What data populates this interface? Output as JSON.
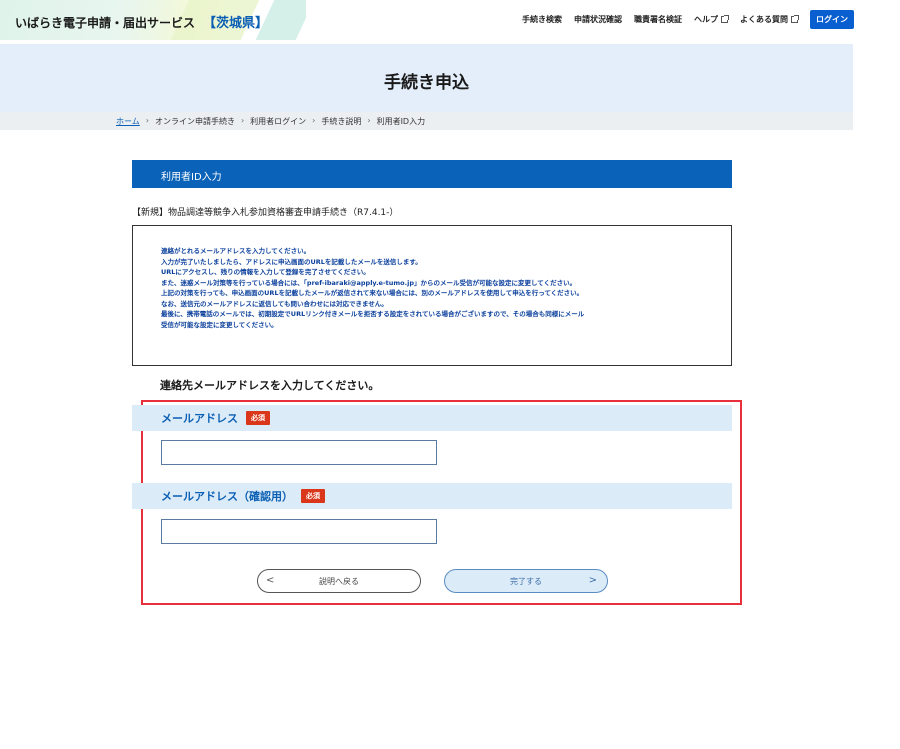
{
  "header": {
    "site_name": "いばらき電子申請・届出サービス",
    "prefecture": "【茨城県】",
    "nav": [
      {
        "label": "手続き検索",
        "external": false
      },
      {
        "label": "申請状況確認",
        "external": false
      },
      {
        "label": "職責署名検証",
        "external": false
      },
      {
        "label": "ヘルプ",
        "external": true
      },
      {
        "label": "よくある質問",
        "external": true
      }
    ],
    "login_label": "ログイン"
  },
  "page": {
    "title": "手続き申込"
  },
  "breadcrumb": {
    "home": "ホーム",
    "items": [
      "オンライン申請手続き",
      "利用者ログイン",
      "手続き説明",
      "利用者ID入力"
    ],
    "separator": "›"
  },
  "main": {
    "section_title": "利用者ID入力",
    "procedure_name": "【新規】物品調達等競争入札参加資格審査申請手続き（R7.4.1-）",
    "notice_lines": [
      "連絡がとれるメールアドレスを入力してください。",
      "入力が完了いたしましたら、アドレスに申込画面のURLを記載したメールを送信します。",
      "URLにアクセスし、残りの情報を入力して登録を完了させてください。",
      "また、迷惑メール対策等を行っている場合には、「pref-ibaraki@apply.e-tumo.jp」からのメール受信が可能な設定に変更してください。",
      "上記の対策を行っても、申込画面のURLを記載したメールが返信されて来ない場合には、別のメールアドレスを使用して申込を行ってください。",
      "なお、送信元のメールアドレスに返信しても問い合わせには対応できません。",
      "最後に、携帯電話のメールでは、初期設定でURLリンク付きメールを拒否する設定をされている場合がございますので、その場合も同様にメール",
      "受信が可能な設定に変更してください。"
    ],
    "instruction": "連絡先メールアドレスを入力してください。",
    "email_label": "メールアドレス",
    "email_confirm_label": "メールアドレス（確認用）",
    "required_badge": "必須",
    "email_value": "",
    "email_confirm_value": "",
    "back_button": "説明へ戻る",
    "submit_button": "完了する"
  }
}
